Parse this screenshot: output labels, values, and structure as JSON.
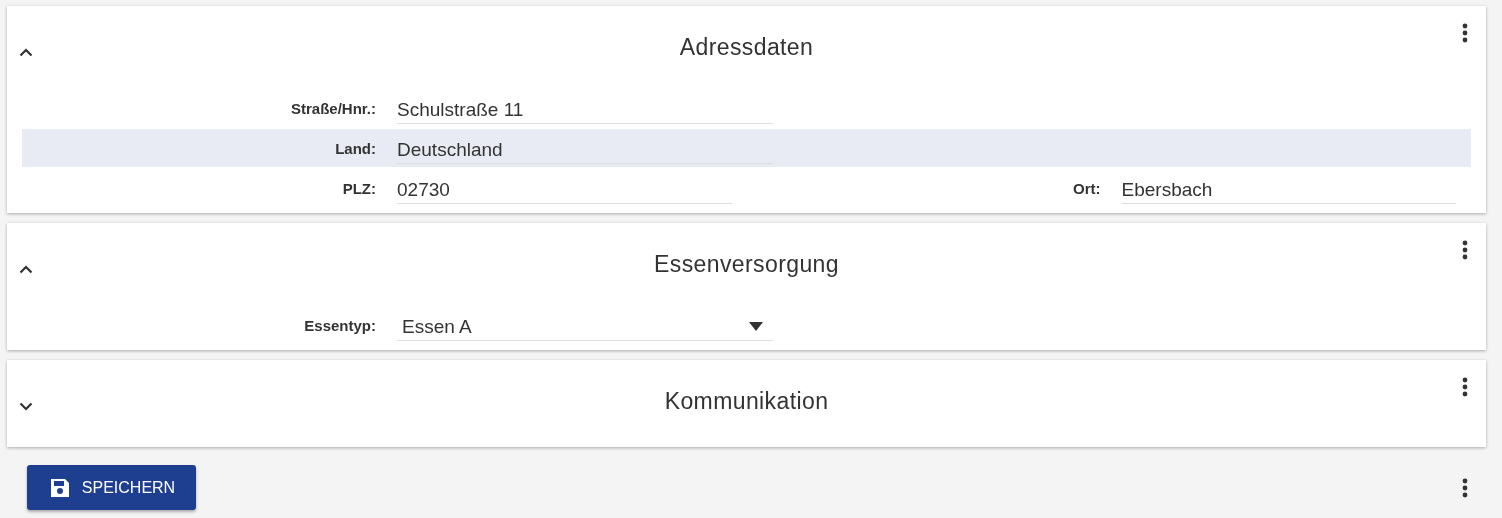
{
  "panels": [
    {
      "title": "Adressdaten",
      "expanded": true,
      "rows": [
        {
          "highlighted": false,
          "fields": [
            {
              "kind": "text",
              "label": "Straße/Hnr.:",
              "value": "Schulstraße 11"
            }
          ]
        },
        {
          "highlighted": true,
          "fields": [
            {
              "kind": "text",
              "label": "Land:",
              "value": "Deutschland"
            }
          ]
        },
        {
          "highlighted": false,
          "fields": [
            {
              "kind": "text",
              "label": "PLZ:",
              "value": "02730"
            },
            {
              "kind": "text",
              "label": "Ort:",
              "value": "Ebersbach"
            }
          ]
        }
      ]
    },
    {
      "title": "Essenversorgung",
      "expanded": true,
      "rows": [
        {
          "highlighted": false,
          "fields": [
            {
              "kind": "select",
              "label": "Essentyp:",
              "value": "Essen A"
            }
          ]
        }
      ]
    },
    {
      "title": "Kommunikation",
      "expanded": false
    }
  ],
  "save_button": {
    "label": "SPEICHERN"
  }
}
